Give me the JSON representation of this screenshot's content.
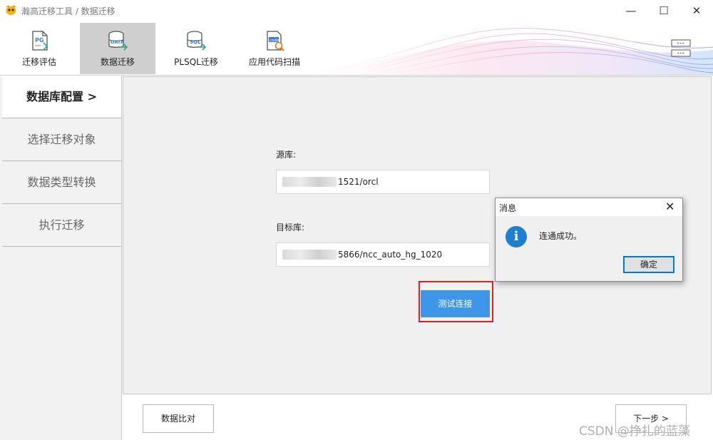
{
  "window": {
    "title": "瀚高迁移工具 / 数据迁移",
    "minimize": "—",
    "maximize": "☐",
    "close": "✕"
  },
  "toolbar": {
    "items": [
      {
        "label": "迁移评估",
        "icon": "pg-file-icon",
        "active": false
      },
      {
        "label": "数据迁移",
        "icon": "data-database-icon",
        "active": true
      },
      {
        "label": "PLSQL迁移",
        "icon": "sql-database-icon",
        "active": false
      },
      {
        "label": "应用代码扫描",
        "icon": "code-scan-icon",
        "active": false
      }
    ],
    "menu_icon": "menu-icon"
  },
  "sidebar": {
    "items": [
      {
        "label": "数据库配置 >",
        "active": true
      },
      {
        "label": "选择迁移对象",
        "active": false
      },
      {
        "label": "数据类型转换",
        "active": false
      },
      {
        "label": "执行迁移",
        "active": false
      }
    ]
  },
  "form": {
    "source_label": "源库:",
    "source_value": "1521/orcl",
    "target_label": "目标库:",
    "target_value": "5866/ncc_auto_hg_1020",
    "test_button": "测试连接"
  },
  "bottom": {
    "compare_button": "数据比对",
    "next_button": "下一步 >"
  },
  "dialog": {
    "title": "消息",
    "close": "✕",
    "icon": "info-icon",
    "message": "连通成功。",
    "ok_button": "确定"
  },
  "watermark": "CSDN @挣扎的蓝藻",
  "colors": {
    "accent": "#3d96e8",
    "highlight": "#e02020",
    "info": "#1f7ed0"
  }
}
